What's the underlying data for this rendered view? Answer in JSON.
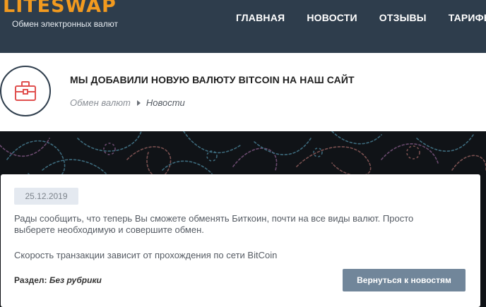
{
  "header": {
    "logo": "LITESWAP",
    "tagline": "Обмен электронных валют",
    "nav": [
      "ГЛАВНАЯ",
      "НОВОСТИ",
      "ОТЗЫВЫ",
      "ТАРИФЫ"
    ]
  },
  "title_band": {
    "icon": "briefcase-icon",
    "title": "МЫ ДОБАВИЛИ НОВУЮ ВАЛЮТУ BITCOIN НА НАШ САЙТ",
    "breadcrumb": {
      "root": "Обмен валют",
      "current": "Новости"
    }
  },
  "article": {
    "date": "25.12.2019",
    "paragraph1": "Рады сообщить, что теперь Вы сможете обменять Биткоин, почти на все виды валют. Просто выберете необходимую и совершите обмен.",
    "paragraph2": "Скорость транзакции зависит от прохождения по сети BitCoin",
    "section_label": "Раздел:",
    "section_value": "Без рубрики",
    "back_button": "Вернуться к новостям"
  },
  "colors": {
    "header_bg": "#2e3d4c",
    "logo": "#f29a1f",
    "icon_accent": "#e0504f",
    "button_bg": "#71869a"
  }
}
